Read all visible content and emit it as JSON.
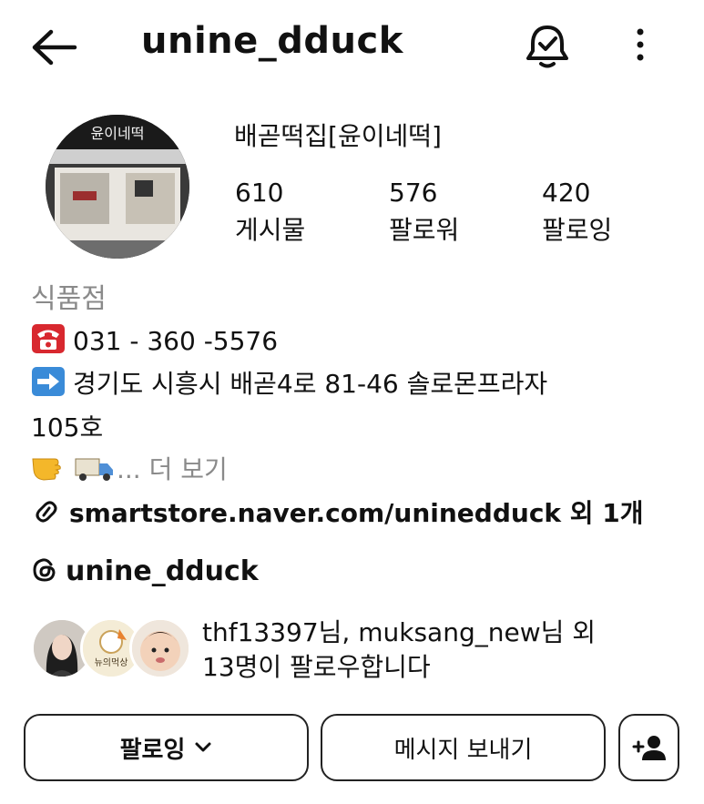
{
  "header": {
    "username": "unine_dduck",
    "back_icon": "arrow-left-icon",
    "bell_icon": "bell-check-icon",
    "more_icon": "more-vertical-icon"
  },
  "profile": {
    "display_name": "배곧떡집[윤이네떡]",
    "avatar_sign_text": "윤이네떡",
    "stats": [
      {
        "value": "610",
        "label": "게시물"
      },
      {
        "value": "576",
        "label": "팔로워"
      },
      {
        "value": "420",
        "label": "팔로잉"
      }
    ],
    "category": "식품점",
    "bio": {
      "phone": "031 - 360 -5576",
      "address_line1": "경기도 시흥시 배곧4로 81-46 솔로몬프라자",
      "address_line2": "105호",
      "more_prefix": "...",
      "more_label": "더 보기"
    },
    "link": {
      "url": "smartstore.naver.com/uninedduck",
      "extra": "외 1개"
    },
    "threads": "unine_dduck",
    "followed_by": {
      "line1": "thf13397님, muksang_new님 외",
      "line2": "13명이 팔로우합니다",
      "avatar2_label": "뉴의먹상"
    }
  },
  "actions": {
    "follow_label": "팔로잉",
    "message_label": "메시지 보내기",
    "add_person_icon": "person-add-icon"
  },
  "colors": {
    "text": "#111111",
    "muted": "#8a8a8a",
    "border": "#222222"
  }
}
